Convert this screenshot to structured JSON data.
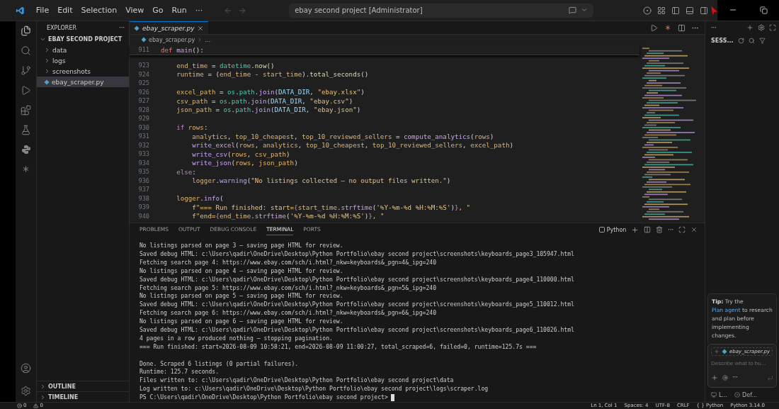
{
  "title_bar": {
    "menu": [
      "File",
      "Edit",
      "Selection",
      "View",
      "Go",
      "Run",
      "···"
    ],
    "search": "ebay second project [Administrator]"
  },
  "explorer": {
    "title": "EXPLORER",
    "more": "···",
    "project": {
      "name": "EBAY SECOND PROJECT",
      "expanded": true,
      "children": [
        {
          "name": "data",
          "kind": "folder",
          "expanded": false,
          "selected": false
        },
        {
          "name": "logs",
          "kind": "folder",
          "expanded": false,
          "selected": false
        },
        {
          "name": "screenshots",
          "kind": "folder",
          "expanded": false,
          "selected": false
        },
        {
          "name": "ebay_scraper.py",
          "kind": "file",
          "selected": true
        }
      ]
    },
    "sections": [
      {
        "name": "OUTLINE",
        "expanded": false
      },
      {
        "name": "TIMELINE",
        "expanded": false
      }
    ]
  },
  "editor": {
    "tabs": [
      {
        "label": "ebay_scraper.py",
        "selected": true
      }
    ],
    "breadcrumb": [
      "ebay_scraper.py",
      "..."
    ],
    "sticky": {
      "number": "911",
      "tokens": [
        {
          "text": "def ",
          "kind": "def"
        },
        {
          "text": "main",
          "kind": "method"
        },
        {
          "text": "():",
          "kind": "punct"
        }
      ]
    },
    "lines": [
      {
        "number": "923",
        "tokens": [
          {
            "text": "    end_time",
            "kind": "var"
          },
          {
            "text": " = ",
            "kind": "punct"
          },
          {
            "text": "datetime",
            "kind": "module"
          },
          {
            "text": ".",
            "kind": "punct"
          },
          {
            "text": "now",
            "kind": "func"
          },
          {
            "text": "()",
            "kind": "punct"
          }
        ]
      },
      {
        "number": "924",
        "tokens": [
          {
            "text": "    runtime",
            "kind": "var"
          },
          {
            "text": " = (",
            "kind": "punct"
          },
          {
            "text": "end_time",
            "kind": "var"
          },
          {
            "text": " - ",
            "kind": "punct"
          },
          {
            "text": "start_time",
            "kind": "var"
          },
          {
            "text": ").",
            "kind": "punct"
          },
          {
            "text": "total_seconds",
            "kind": "func"
          },
          {
            "text": "()",
            "kind": "punct"
          }
        ]
      },
      {
        "number": "925"
      },
      {
        "number": "926",
        "tokens": [
          {
            "text": "    excel_path",
            "kind": "var"
          },
          {
            "text": " = ",
            "kind": "punct"
          },
          {
            "text": "os",
            "kind": "module"
          },
          {
            "text": ".",
            "kind": "punct"
          },
          {
            "text": "path",
            "kind": "module"
          },
          {
            "text": ".",
            "kind": "punct"
          },
          {
            "text": "join",
            "kind": "method"
          },
          {
            "text": "(",
            "kind": "punct"
          },
          {
            "text": "DATA_DIR",
            "kind": "const"
          },
          {
            "text": ", ",
            "kind": "punct"
          },
          {
            "text": "\"ebay.xlsx\"",
            "kind": "str"
          },
          {
            "text": ")",
            "kind": "punct"
          }
        ]
      },
      {
        "number": "927",
        "tokens": [
          {
            "text": "    csv_path",
            "kind": "var"
          },
          {
            "text": " = ",
            "kind": "punct"
          },
          {
            "text": "os",
            "kind": "module"
          },
          {
            "text": ".",
            "kind": "punct"
          },
          {
            "text": "path",
            "kind": "module"
          },
          {
            "text": ".",
            "kind": "punct"
          },
          {
            "text": "join",
            "kind": "method"
          },
          {
            "text": "(",
            "kind": "punct"
          },
          {
            "text": "DATA_DIR",
            "kind": "const"
          },
          {
            "text": ", ",
            "kind": "punct"
          },
          {
            "text": "\"ebay.csv\"",
            "kind": "str"
          },
          {
            "text": ")",
            "kind": "punct"
          }
        ]
      },
      {
        "number": "928",
        "tokens": [
          {
            "text": "    json_path",
            "kind": "var"
          },
          {
            "text": " = ",
            "kind": "punct"
          },
          {
            "text": "os",
            "kind": "module"
          },
          {
            "text": ".",
            "kind": "punct"
          },
          {
            "text": "path",
            "kind": "module"
          },
          {
            "text": ".",
            "kind": "punct"
          },
          {
            "text": "join",
            "kind": "method"
          },
          {
            "text": "(",
            "kind": "punct"
          },
          {
            "text": "DATA_DIR",
            "kind": "const"
          },
          {
            "text": ", ",
            "kind": "punct"
          },
          {
            "text": "\"ebay.json\"",
            "kind": "str"
          },
          {
            "text": ")",
            "kind": "punct"
          }
        ]
      },
      {
        "number": "929"
      },
      {
        "number": "930",
        "tokens": [
          {
            "text": "    if ",
            "kind": "kw"
          },
          {
            "text": "rows",
            "kind": "var"
          },
          {
            "text": ":",
            "kind": "punct"
          }
        ]
      },
      {
        "number": "931",
        "tokens": [
          {
            "text": "        analytics",
            "kind": "var"
          },
          {
            "text": ", ",
            "kind": "punct"
          },
          {
            "text": "top_10_cheapest",
            "kind": "var"
          },
          {
            "text": ", ",
            "kind": "punct"
          },
          {
            "text": "top_10_reviewed_sellers",
            "kind": "var"
          },
          {
            "text": " = ",
            "kind": "punct"
          },
          {
            "text": "compute_analytics",
            "kind": "method"
          },
          {
            "text": "(",
            "kind": "punct"
          },
          {
            "text": "rows",
            "kind": "var"
          },
          {
            "text": ")",
            "kind": "punct"
          }
        ]
      },
      {
        "number": "932",
        "tokens": [
          {
            "text": "        write_excel",
            "kind": "method"
          },
          {
            "text": "(",
            "kind": "punct"
          },
          {
            "text": "rows",
            "kind": "var"
          },
          {
            "text": ", ",
            "kind": "punct"
          },
          {
            "text": "analytics",
            "kind": "var"
          },
          {
            "text": ", ",
            "kind": "punct"
          },
          {
            "text": "top_10_cheapest",
            "kind": "var"
          },
          {
            "text": ", ",
            "kind": "punct"
          },
          {
            "text": "top_10_reviewed_sellers",
            "kind": "var"
          },
          {
            "text": ", ",
            "kind": "punct"
          },
          {
            "text": "excel_path",
            "kind": "var"
          },
          {
            "text": ")",
            "kind": "punct"
          }
        ]
      },
      {
        "number": "933",
        "tokens": [
          {
            "text": "        write_csv",
            "kind": "method"
          },
          {
            "text": "(",
            "kind": "punct"
          },
          {
            "text": "rows",
            "kind": "var"
          },
          {
            "text": ", ",
            "kind": "punct"
          },
          {
            "text": "csv_path",
            "kind": "var"
          },
          {
            "text": ")",
            "kind": "punct"
          }
        ]
      },
      {
        "number": "934",
        "tokens": [
          {
            "text": "        write_json",
            "kind": "method"
          },
          {
            "text": "(",
            "kind": "punct"
          },
          {
            "text": "rows",
            "kind": "var"
          },
          {
            "text": ", ",
            "kind": "punct"
          },
          {
            "text": "json_path",
            "kind": "var"
          },
          {
            "text": ")",
            "kind": "punct"
          }
        ]
      },
      {
        "number": "935",
        "tokens": [
          {
            "text": "    else",
            "kind": "kw"
          },
          {
            "text": ":",
            "kind": "punct"
          }
        ]
      },
      {
        "number": "936",
        "tokens": [
          {
            "text": "        logger",
            "kind": "var"
          },
          {
            "text": ".",
            "kind": "punct"
          },
          {
            "text": "warning",
            "kind": "method"
          },
          {
            "text": "(",
            "kind": "punct"
          },
          {
            "text": "\"No listings collected — no output files written.\"",
            "kind": "str"
          },
          {
            "text": ")",
            "kind": "punct"
          }
        ]
      },
      {
        "number": "937"
      },
      {
        "number": "938",
        "tokens": [
          {
            "text": "    logger",
            "kind": "var"
          },
          {
            "text": ".",
            "kind": "punct"
          },
          {
            "text": "info",
            "kind": "method"
          },
          {
            "text": "(",
            "kind": "punct"
          }
        ]
      },
      {
        "number": "939",
        "tokens": [
          {
            "text": "        f\"=== Run finished: start=",
            "kind": "str"
          },
          {
            "text": "{",
            "kind": "kw"
          },
          {
            "text": "start_time",
            "kind": "var"
          },
          {
            "text": ".",
            "kind": "punct"
          },
          {
            "text": "strftime",
            "kind": "method"
          },
          {
            "text": "(",
            "kind": "punct"
          },
          {
            "text": "'%Y-%m-%d %H:%M:%S'",
            "kind": "str"
          },
          {
            "text": ")",
            "kind": "punct"
          },
          {
            "text": "}",
            "kind": "kw"
          },
          {
            "text": ", \"",
            "kind": "str"
          }
        ]
      },
      {
        "number": "940",
        "tokens": [
          {
            "text": "        f\"end=",
            "kind": "str"
          },
          {
            "text": "{",
            "kind": "kw"
          },
          {
            "text": "end_time",
            "kind": "var"
          },
          {
            "text": ".",
            "kind": "punct"
          },
          {
            "text": "strftime",
            "kind": "method"
          },
          {
            "text": "(",
            "kind": "punct"
          },
          {
            "text": "'%Y-%m-%d %H:%M:%S'",
            "kind": "str"
          },
          {
            "text": ")",
            "kind": "punct"
          },
          {
            "text": "}",
            "kind": "kw"
          },
          {
            "text": ", \"",
            "kind": "str"
          }
        ]
      }
    ]
  },
  "panel": {
    "tabs": [
      {
        "label": "PROBLEMS",
        "selected": false
      },
      {
        "label": "OUTPUT",
        "selected": false
      },
      {
        "label": "DEBUG CONSOLE",
        "selected": false
      },
      {
        "label": "TERMINAL",
        "selected": true
      },
      {
        "label": "PORTS",
        "selected": false
      }
    ],
    "shell": "Python",
    "more": "···",
    "terminal_blocks": [
      [
        "No listings parsed on page 3 — saving page HTML for review.",
        "Saved debug HTML: c:\\Users\\qadir\\OneDrive\\Desktop\\Python Portfolio\\ebay second project\\screenshots\\keyboards_page3_105947.html",
        "Fetching search page 4: https://www.ebay.com/sch/i.html?_nkw=keyboards&_pgn=4&_ipg=240",
        "No listings parsed on page 4 — saving page HTML for review.",
        "Saved debug HTML: c:\\Users\\qadir\\OneDrive\\Desktop\\Python Portfolio\\ebay second project\\screenshots\\keyboards_page4_110000.html",
        "Fetching search page 5: https://www.ebay.com/sch/i.html?_nkw=keyboards&_pgn=5&_ipg=240",
        "No listings parsed on page 5 — saving page HTML for review.",
        "Saved debug HTML: c:\\Users\\qadir\\OneDrive\\Desktop\\Python Portfolio\\ebay second project\\screenshots\\keyboards_page5_110012.html",
        "Fetching search page 6: https://www.ebay.com/sch/i.html?_nkw=keyboards&_pgn=6&_ipg=240",
        "No listings parsed on page 6 — saving page HTML for review.",
        "Saved debug HTML: c:\\Users\\qadir\\OneDrive\\Desktop\\Python Portfolio\\ebay second project\\screenshots\\keyboards_page6_110026.html",
        "4 pages in a row produced nothing — stopping pagination.",
        "=== Run finished: start=2026-08-09 10:58:21, end=2026-08-09 11:00:27, total_scraped=6, failed=0, runtime=125.7s ==="
      ],
      [
        "Done. Scraped 6 listings (0 partial failures).",
        "Runtime: 125.7 seconds.",
        "Files written to: c:\\Users\\qadir\\OneDrive\\Desktop\\Python Portfolio\\ebay second project\\data",
        "Log written to: c:\\Users\\qadir\\OneDrive\\Desktop\\Python Portfolio\\ebay second project\\logs\\scraper.log"
      ]
    ],
    "prompt": "PS C:\\Users\\qadir\\OneDrive\\Desktop\\Python Portfolio\\ebay second project>"
  },
  "chat": {
    "more": "···",
    "title": "SESS...",
    "tip": {
      "label": "Tip:",
      "before": "Try the",
      "link": "Plan agent",
      "after": "to research and plan before implementing changes."
    },
    "context_file": "ebay_scraper.py",
    "placeholder": "Describe what to bu...",
    "more_actions": "···",
    "footer": [
      "L...",
      "Def..."
    ]
  },
  "status_bar": {
    "errors": "0",
    "warnings": "0",
    "items": [
      "Ln 1, Col 1",
      "Spaces: 4",
      "UTF-8",
      "CRLF",
      "{ } Python",
      "Python 3.14.0"
    ]
  }
}
